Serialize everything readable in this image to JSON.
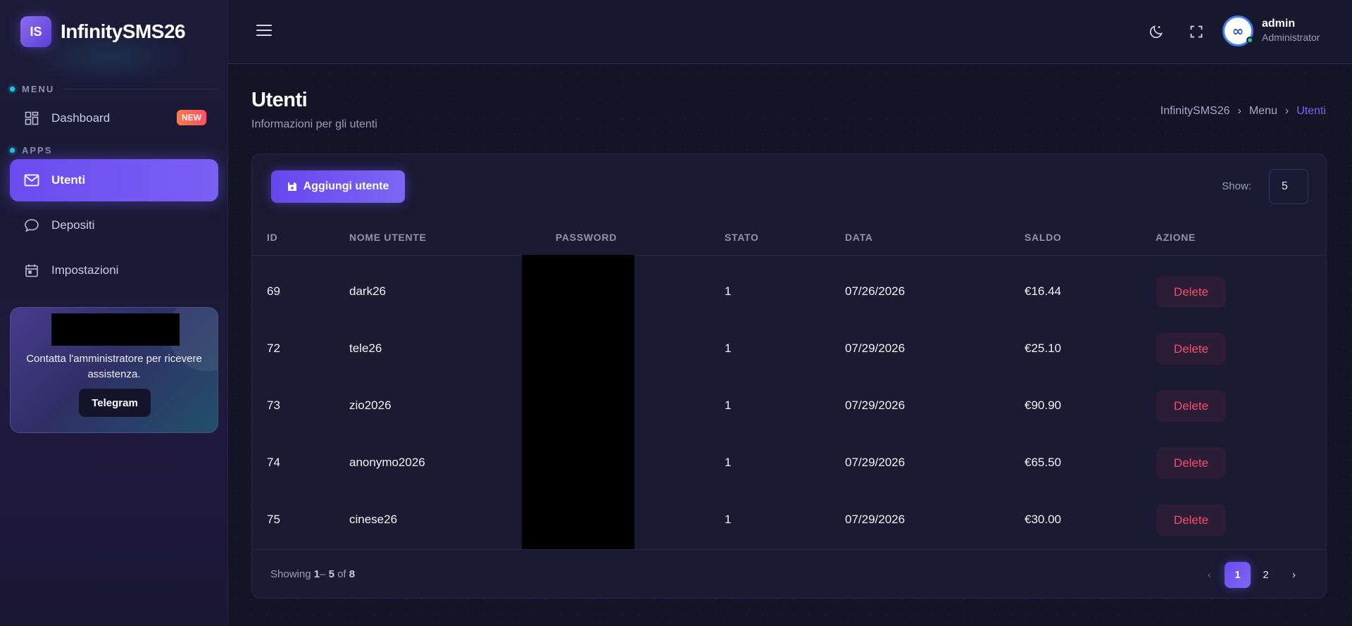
{
  "brand": {
    "logo_text": "IS",
    "name": "InfinitySMS26"
  },
  "sidebar": {
    "sections": [
      {
        "label": "MENU"
      },
      {
        "label": "APPS"
      }
    ],
    "items": [
      {
        "label": "Dashboard",
        "icon": "dashboard-grid-icon",
        "badge": "NEW"
      },
      {
        "label": "Utenti",
        "icon": "mail-icon",
        "active": true
      },
      {
        "label": "Depositi",
        "icon": "chat-bubble-icon"
      },
      {
        "label": "Impostazioni",
        "icon": "calendar-icon"
      }
    ],
    "help_card": {
      "text": "Contatta l'amministratore per ricevere assistenza.",
      "button_label": "Telegram"
    }
  },
  "topbar": {
    "icons": [
      "menu-icon",
      "moon-icon",
      "fullscreen-icon"
    ],
    "user": {
      "name": "admin",
      "role": "Administrator",
      "avatar_text": "∞"
    }
  },
  "page": {
    "title": "Utenti",
    "subtitle": "Informazioni per gli utenti",
    "breadcrumb": [
      "InfinitySMS26",
      "Menu",
      "Utenti"
    ]
  },
  "table": {
    "add_button_label": "Aggiungi utente",
    "show_label": "Show:",
    "show_value": "5",
    "columns": [
      "ID",
      "NOME UTENTE",
      "PASSWORD",
      "STATO",
      "DATA",
      "SALDO",
      "AZIONE"
    ],
    "rows": [
      {
        "id": "69",
        "username": "dark26",
        "stato": "1",
        "data": "07/26/2026",
        "saldo": "€16.44",
        "action": "Delete"
      },
      {
        "id": "72",
        "username": "tele26",
        "stato": "1",
        "data": "07/29/2026",
        "saldo": "€25.10",
        "action": "Delete"
      },
      {
        "id": "73",
        "username": "zio2026",
        "stato": "1",
        "data": "07/29/2026",
        "saldo": "€90.90",
        "action": "Delete"
      },
      {
        "id": "74",
        "username": "anonymo2026",
        "stato": "1",
        "data": "07/29/2026",
        "saldo": "€65.50",
        "action": "Delete"
      },
      {
        "id": "75",
        "username": "cinese26",
        "stato": "1",
        "data": "07/29/2026",
        "saldo": "€30.00",
        "action": "Delete"
      }
    ],
    "footer": {
      "showing_prefix": "Showing",
      "from": "1",
      "dash": "–",
      "to": "5",
      "of_word": "of",
      "total": "8"
    },
    "pagination": {
      "prev": "‹",
      "pages": [
        "1",
        "2"
      ],
      "current": "1",
      "next": "›"
    }
  },
  "colors": {
    "accent": "#6a4cf0",
    "danger": "#ef4f6e",
    "background": "#131426",
    "status_online": "#25c48a"
  }
}
